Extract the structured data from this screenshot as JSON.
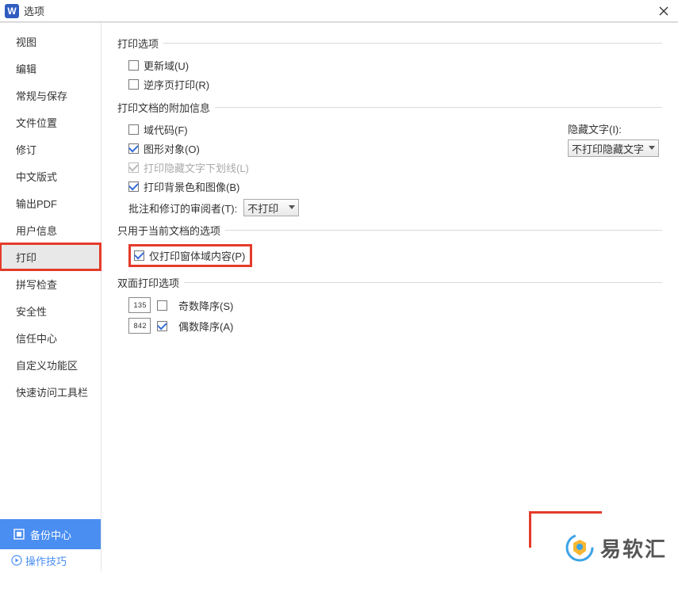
{
  "titlebar": {
    "icon_letter": "W",
    "title": "选项"
  },
  "sidebar": {
    "items": [
      "视图",
      "编辑",
      "常规与保存",
      "文件位置",
      "修订",
      "中文版式",
      "输出PDF",
      "用户信息",
      "打印",
      "拼写检查",
      "安全性",
      "信任中心",
      "自定义功能区",
      "快速访问工具栏"
    ],
    "selected_index": 8,
    "backup_label": "备份中心",
    "tips_label": "操作技巧"
  },
  "content": {
    "group1": {
      "title": "打印选项",
      "update_fields": "更新域(U)",
      "reverse_order": "逆序页打印(R)"
    },
    "group2": {
      "title": "打印文档的附加信息",
      "field_codes": "域代码(F)",
      "graphics": "图形对象(O)",
      "hidden_underline": "打印隐藏文字下划线(L)",
      "background": "打印背景色和图像(B)",
      "reviewer_label": "批注和修订的审阅者(T):",
      "reviewer_value": "不打印",
      "hidden_text_label": "隐藏文字(I):",
      "hidden_text_value": "不打印隐藏文字"
    },
    "group3": {
      "title": "只用于当前文档的选项",
      "only_form": "仅打印窗体域内容(P)"
    },
    "group4": {
      "title": "双面打印选项",
      "odd_icon": "1 3 5",
      "odd_label": "奇数降序(S)",
      "even_icon": "8 4 2",
      "even_label": "偶数降序(A)"
    }
  },
  "logo": {
    "text": "易软汇"
  }
}
